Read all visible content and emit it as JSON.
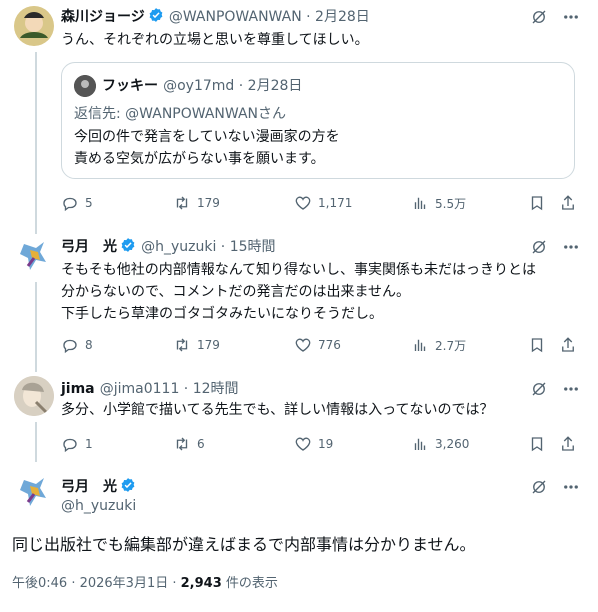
{
  "tweets": [
    {
      "name": "森川ジョージ",
      "handle": "@WANPOWANWAN",
      "time": "2月28日",
      "body": "うん、それぞれの立場と思いを尊重してほしい。",
      "quote": {
        "name": "フッキー",
        "handle": "@oy17md",
        "time": "2月28日",
        "reply_to": "返信先: @WANPOWANWANさん",
        "body": [
          "今回の件で発言をしていない漫画家の方を",
          "責める空気が広がらない事を願います。"
        ]
      },
      "stats": {
        "replies": "5",
        "retweets": "179",
        "likes": "1,171",
        "views": "5.5万"
      }
    },
    {
      "name": "弓月　光",
      "handle": "@h_yuzuki",
      "time": "15時間",
      "body": [
        "そもそも他社の内部情報なんて知り得ないし、事実関係も未だはっきりとは",
        "分からないので、コメントだの発言だのは出来ません。",
        "下手したら草津のゴタゴタみたいになりそうだし。"
      ],
      "stats": {
        "replies": "8",
        "retweets": "179",
        "likes": "776",
        "views": "2.7万"
      }
    },
    {
      "name": "jima",
      "handle": "@jima0111",
      "time": "12時間",
      "body": "多分、小学館で描いてる先生でも、詳しい情報は入ってないのでは？",
      "stats": {
        "replies": "1",
        "retweets": "6",
        "likes": "19",
        "views": "3,260"
      }
    }
  ],
  "main": {
    "name": "弓月　光",
    "handle": "@h_yuzuki",
    "body": "同じ出版社でも編集部が違えばまるで内部事情は分かりません。",
    "timestamp": "午後0:46 · 2026年3月1日 · ",
    "views": "2,943",
    "views_suffix": " 件の表示"
  },
  "separator": " · ",
  "colors": {
    "verified": "#1d9bf0",
    "text": "#0f1419",
    "muted": "#536471",
    "border": "#cfd9de"
  }
}
